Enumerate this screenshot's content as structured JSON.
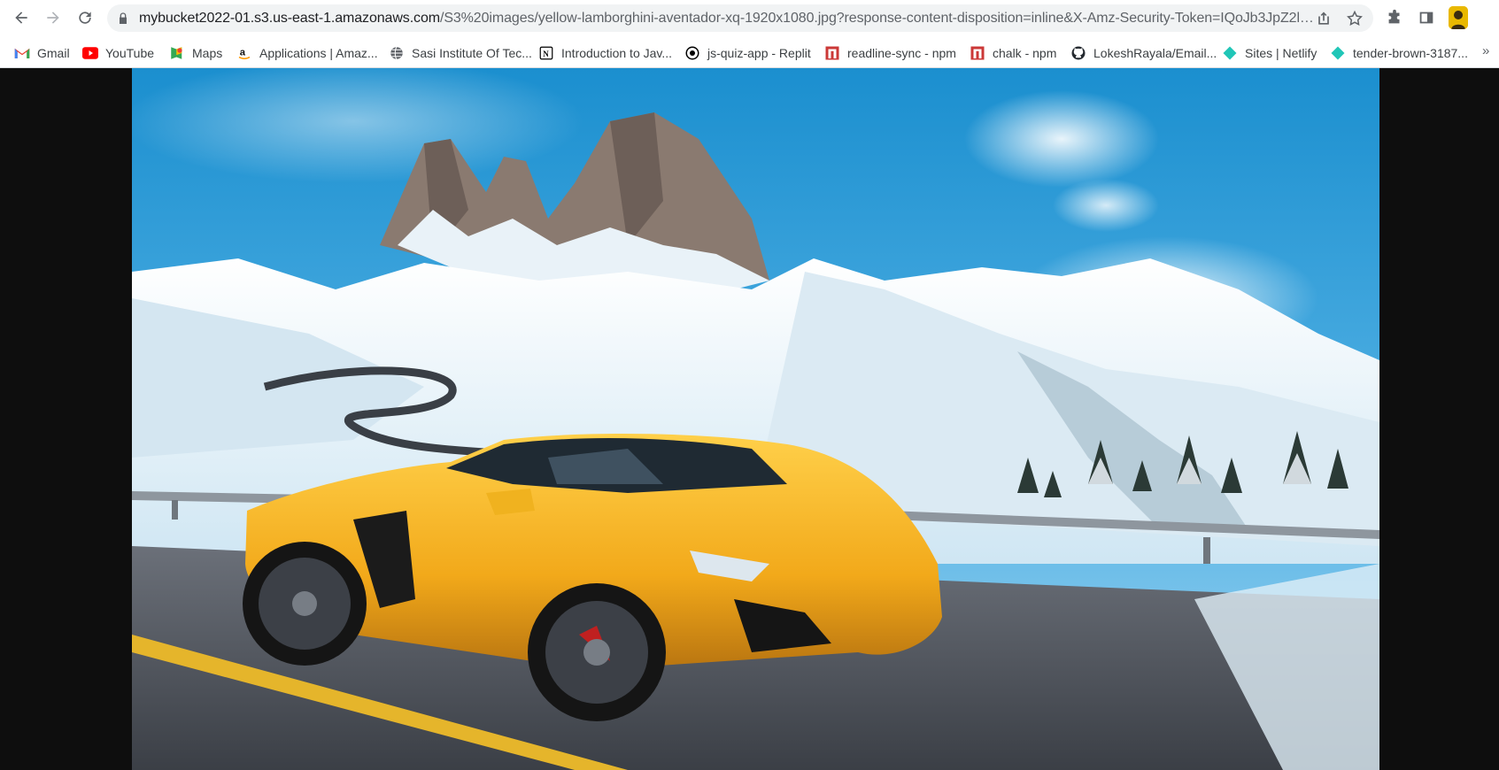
{
  "browser": {
    "url_host": "mybucket2022-01.s3.us-east-1.amazonaws.com",
    "url_rest": "/S3%20images/yellow-lamborghini-aventador-xq-1920x1080.jpg?response-content-disposition=inline&X-Amz-Security-Token=IQoJb3JpZ2luX...",
    "nav_icons": [
      "arrow-left-icon",
      "arrow-right-icon",
      "reload-icon"
    ],
    "omnibox_icons": [
      "lock-icon",
      "share-icon",
      "star-icon"
    ],
    "toolbar_icons": [
      "extensions-icon",
      "side-panel-icon",
      "profile-avatar"
    ]
  },
  "bookmarks": [
    {
      "label": "Gmail",
      "icon": "gmail-icon",
      "color": "#ea4335"
    },
    {
      "label": "YouTube",
      "icon": "youtube-icon",
      "color": "#ff0000"
    },
    {
      "label": "Maps",
      "icon": "maps-icon",
      "color": "#34a853"
    },
    {
      "label": "Applications | Amaz...",
      "icon": "amazon-icon",
      "color": "#111111"
    },
    {
      "label": "Sasi Institute Of Tec...",
      "icon": "globe-icon",
      "color": "#5f6368"
    },
    {
      "label": "Introduction to Jav...",
      "icon": "notion-icon",
      "color": "#000000"
    },
    {
      "label": "js-quiz-app - Replit",
      "icon": "replit-icon",
      "color": "#000000"
    },
    {
      "label": "readline-sync - npm",
      "icon": "npm-icon",
      "color": "#cb3837"
    },
    {
      "label": "chalk - npm",
      "icon": "npm-icon",
      "color": "#cb3837"
    },
    {
      "label": "LokeshRayala/Email...",
      "icon": "github-icon",
      "color": "#24292f"
    },
    {
      "label": "Sites | Netlify",
      "icon": "netlify-icon",
      "color": "#20c6b7"
    },
    {
      "label": "tender-brown-3187...",
      "icon": "netlify-icon",
      "color": "#20c6b7"
    }
  ],
  "bookmarks_overflow": "»",
  "image": {
    "subject": "yellow-lamborghini-aventador",
    "colors": {
      "sky": "#2a9fd6",
      "snow": "#eef6fb",
      "car": "#f2b21c",
      "road": "#4a4f57"
    }
  }
}
